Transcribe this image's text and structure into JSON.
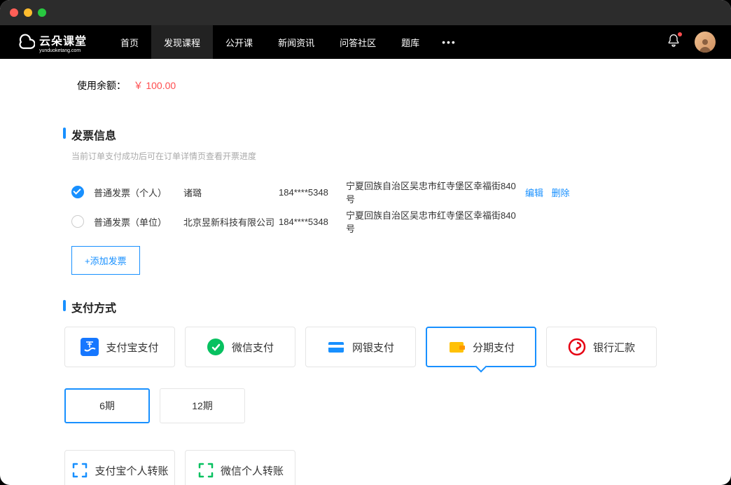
{
  "brand": {
    "name": "云朵课堂",
    "sub": "yunduoketang.com"
  },
  "nav": {
    "items": [
      "首页",
      "发现课程",
      "公开课",
      "新闻资讯",
      "问答社区",
      "题库"
    ],
    "active_index": 1
  },
  "balance": {
    "label": "使用余额：",
    "amount": "￥ 100.00"
  },
  "invoice": {
    "title": "发票信息",
    "hint": "当前订单支付成功后可在订单详情页查看开票进度",
    "rows": [
      {
        "type": "普通发票（个人）",
        "name": "诸璐",
        "phone": "184****5348",
        "addr": "宁夏回族自治区吴忠市红寺堡区幸福街840号",
        "checked": true,
        "edit": "编辑",
        "del": "删除"
      },
      {
        "type": "普通发票（单位）",
        "name": "北京昱新科技有限公司",
        "phone": "184****5348",
        "addr": "宁夏回族自治区吴忠市红寺堡区幸福街840号",
        "checked": false
      }
    ],
    "add": "+添加发票"
  },
  "payment": {
    "title": "支付方式",
    "methods": [
      "支付宝支付",
      "微信支付",
      "网银支付",
      "分期支付",
      "银行汇款"
    ],
    "selected_index": 3,
    "periods": [
      "6期",
      "12期"
    ],
    "period_selected": 0,
    "transfers": [
      "支付宝个人转账",
      "微信个人转账"
    ]
  }
}
